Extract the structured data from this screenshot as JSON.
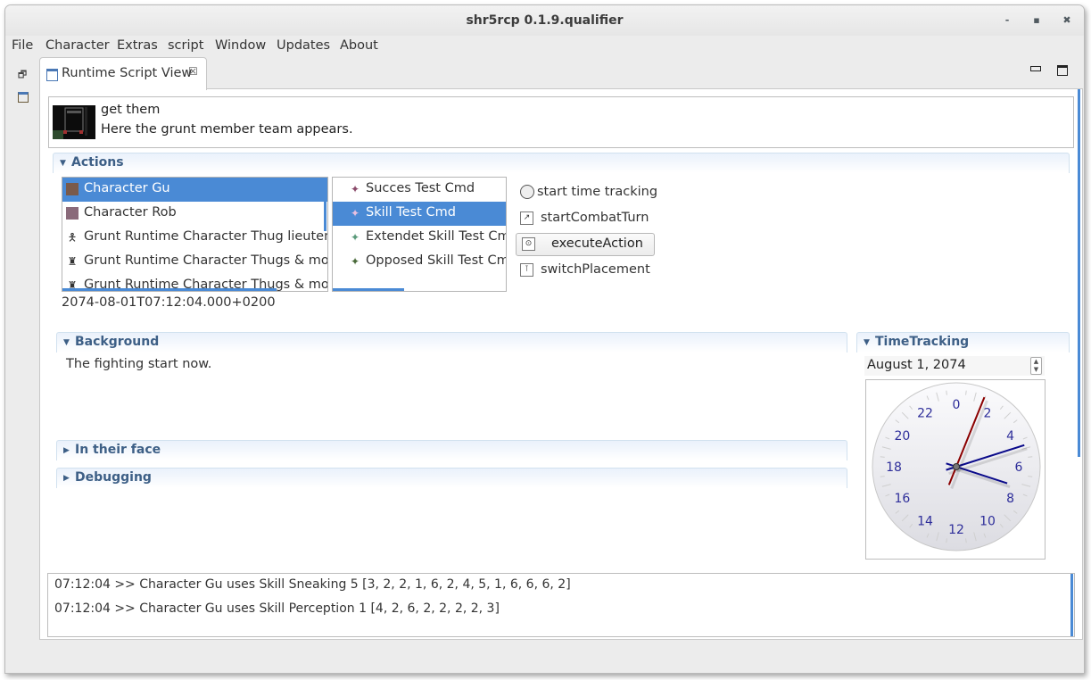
{
  "window": {
    "title": "shr5rcp 0.1.9.qualifier",
    "controls": {
      "minimize": "-",
      "maximize": "▪",
      "close": "✖"
    }
  },
  "menubar": [
    "File",
    "Character",
    "Extras",
    "script",
    "Window",
    "Updates",
    "About"
  ],
  "view_tab": {
    "label": "Runtime Script View",
    "close_glyph": "☒"
  },
  "view_controls": {
    "minimize": "▭",
    "maximize": "🗖"
  },
  "header": {
    "title": "get them",
    "description": "Here the grunt member team appears."
  },
  "actions": {
    "title": "Actions",
    "characters": [
      {
        "label": "Character Gu",
        "icon": "portrait-icon",
        "selected": true
      },
      {
        "label": "Character Rob",
        "icon": "portrait-icon",
        "selected": false
      },
      {
        "label": "Grunt Runtime Character Thug lieutenant",
        "icon": "grunt-icon",
        "selected": false
      },
      {
        "label": "Grunt Runtime Character Thugs & mouth b",
        "icon": "grunt-group-icon",
        "selected": false
      },
      {
        "label": "Grunt Runtime Character Thugs & mouth b",
        "icon": "grunt-group-icon",
        "selected": false
      }
    ],
    "commands": [
      {
        "label": "Succes Test Cmd",
        "selected": false,
        "color": "#8a4a6a"
      },
      {
        "label": "Skill Test Cmd",
        "selected": true,
        "color": "#c08ab0"
      },
      {
        "label": "Extendet Skill Test Cmd",
        "selected": false,
        "color": "#5a9a7a"
      },
      {
        "label": "Opposed Skill Test Cmd",
        "selected": false,
        "color": "#4a6a3a"
      }
    ],
    "buttons": {
      "start_time_tracking": "start time tracking",
      "start_combat_turn": "startCombatTurn",
      "execute_action": "executeAction",
      "switch_placement": "switchPlacement"
    },
    "timestamp": "2074-08-01T07:12:04.000+0200"
  },
  "background": {
    "title": "Background",
    "text": "The fighting start now."
  },
  "collapsed_sections": [
    {
      "title": "In their face"
    },
    {
      "title": "Debugging"
    }
  ],
  "time_tracking": {
    "title": "TimeTracking",
    "date": "August 1, 2074",
    "clock": {
      "labels": [
        "0",
        "2",
        "4",
        "6",
        "8",
        "10",
        "12",
        "14",
        "16",
        "18",
        "20",
        "22"
      ],
      "time": "07:12:04"
    }
  },
  "log": [
    "07:12:04 >> Character Gu uses Skill Sneaking 5 [3, 2, 2, 1, 6, 2, 4, 5, 1, 6, 6, 6, 2]",
    "07:12:04 >> Character Gu uses Skill Perception 1 [4, 2, 6, 2, 2, 2, 2, 3]"
  ],
  "colors": {
    "selection": "#4a8ad5",
    "section_title": "#3d5f86",
    "clock_numbers": "#2e2e9a",
    "hand_hour_minute": "#0a0a8a",
    "hand_second": "#8b0000"
  }
}
